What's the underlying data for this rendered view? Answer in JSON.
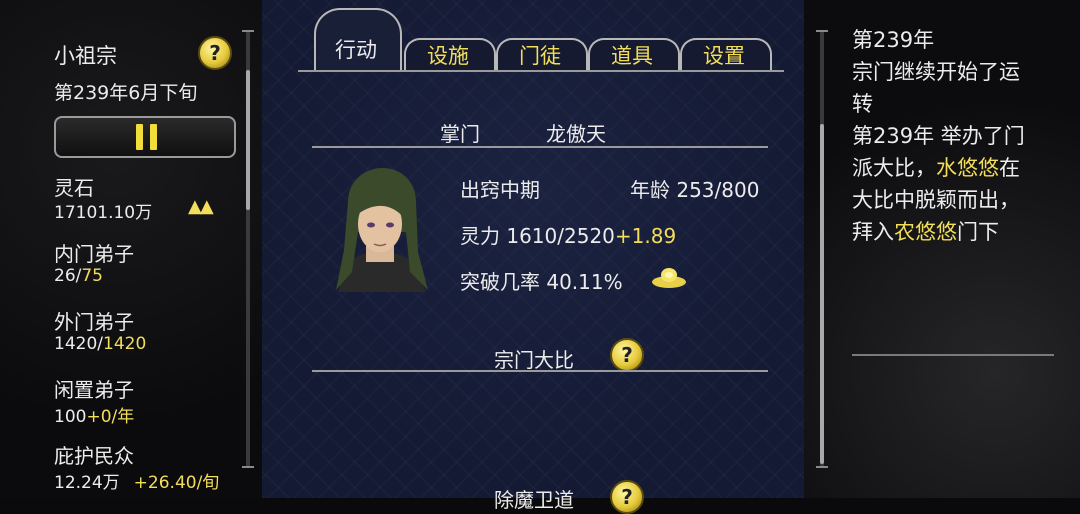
{
  "left": {
    "sect_name": "小祖宗",
    "date": "第239年6月下旬",
    "stats": [
      {
        "label": "灵石",
        "value": "17101.10万",
        "extra": ""
      },
      {
        "label": "内门弟子",
        "value": "26/",
        "extra": "75"
      },
      {
        "label": "外门弟子",
        "value": "1420/",
        "extra": "1420"
      },
      {
        "label": "闲置弟子",
        "value": "100",
        "extra": "+0/年"
      },
      {
        "label": "庇护民众",
        "value": "12.24万",
        "extra": "+26.40/旬"
      }
    ],
    "spirit_arrows": "▲▲"
  },
  "tabs": [
    {
      "label": "行动",
      "active": true
    },
    {
      "label": "设施",
      "active": false
    },
    {
      "label": "门徒",
      "active": false
    },
    {
      "label": "道具",
      "active": false
    },
    {
      "label": "设置",
      "active": false
    }
  ],
  "leader": {
    "title": "掌门",
    "name": "龙傲天",
    "realm": "出窍中期",
    "age_label": "年龄",
    "age_value": "253/800",
    "power_label": "灵力",
    "power_value": "1610/2520",
    "power_rate": "+1.89",
    "breakthrough_label": "突破几率",
    "breakthrough_value": "40.11%"
  },
  "sections": {
    "tournament": "宗门大比",
    "demon": "除魔卫道"
  },
  "help_glyph": "?",
  "log": {
    "lines": [
      {
        "parts": [
          {
            "text": "第239年",
            "hl": false
          }
        ]
      },
      {
        "parts": [
          {
            "text": "宗门继续开始了运",
            "hl": false
          }
        ]
      },
      {
        "parts": [
          {
            "text": "转",
            "hl": false
          }
        ]
      },
      {
        "parts": [
          {
            "text": "第239年 举办了门",
            "hl": false
          }
        ]
      },
      {
        "parts": [
          {
            "text": "派大比，",
            "hl": false
          },
          {
            "text": "水悠悠",
            "hl": true
          },
          {
            "text": "在",
            "hl": false
          }
        ]
      },
      {
        "parts": [
          {
            "text": "大比中脱颖而出，",
            "hl": false
          }
        ]
      },
      {
        "parts": [
          {
            "text": "拜入",
            "hl": false
          },
          {
            "text": "农悠悠",
            "hl": true
          },
          {
            "text": "门下",
            "hl": false
          }
        ]
      }
    ]
  },
  "colors": {
    "accent": "#f2de5a",
    "panel": "#141a33"
  }
}
